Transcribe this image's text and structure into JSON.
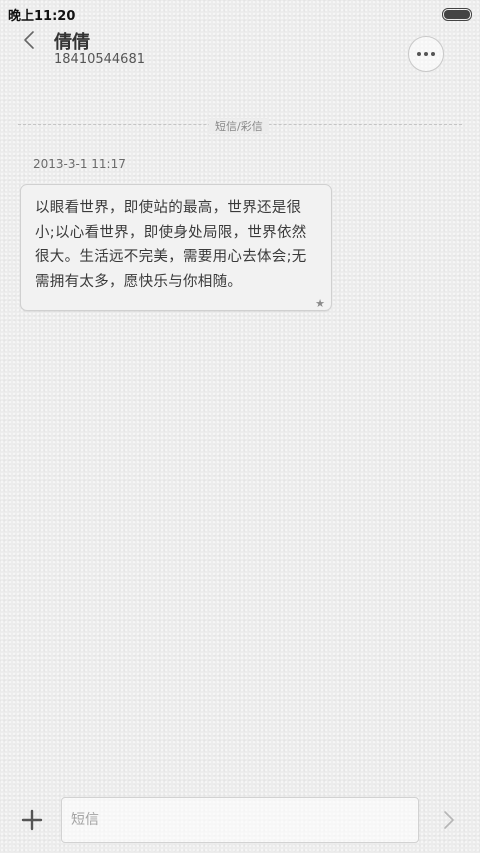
{
  "status_bar": {
    "time": "晚上11:20"
  },
  "header": {
    "contact_name": "倩倩",
    "phone_number": "18410544681"
  },
  "conversation": {
    "divider_label": "短信/彩信",
    "messages": [
      {
        "timestamp": "2013-3-1 11:17",
        "text": "以眼看世界，即使站的最高，世界还是很小;以心看世界，即使身处局限，世界依然很大。生活远不完美，需要用心去体会;无需拥有太多，愿快乐与你相随。",
        "starred": true
      }
    ]
  },
  "composer": {
    "placeholder": "短信",
    "value": ""
  },
  "icons": {
    "back": "back-arrow-icon",
    "more": "more-dots-icon",
    "star": "star-icon",
    "add": "plus-icon",
    "send": "send-arrow-icon"
  }
}
